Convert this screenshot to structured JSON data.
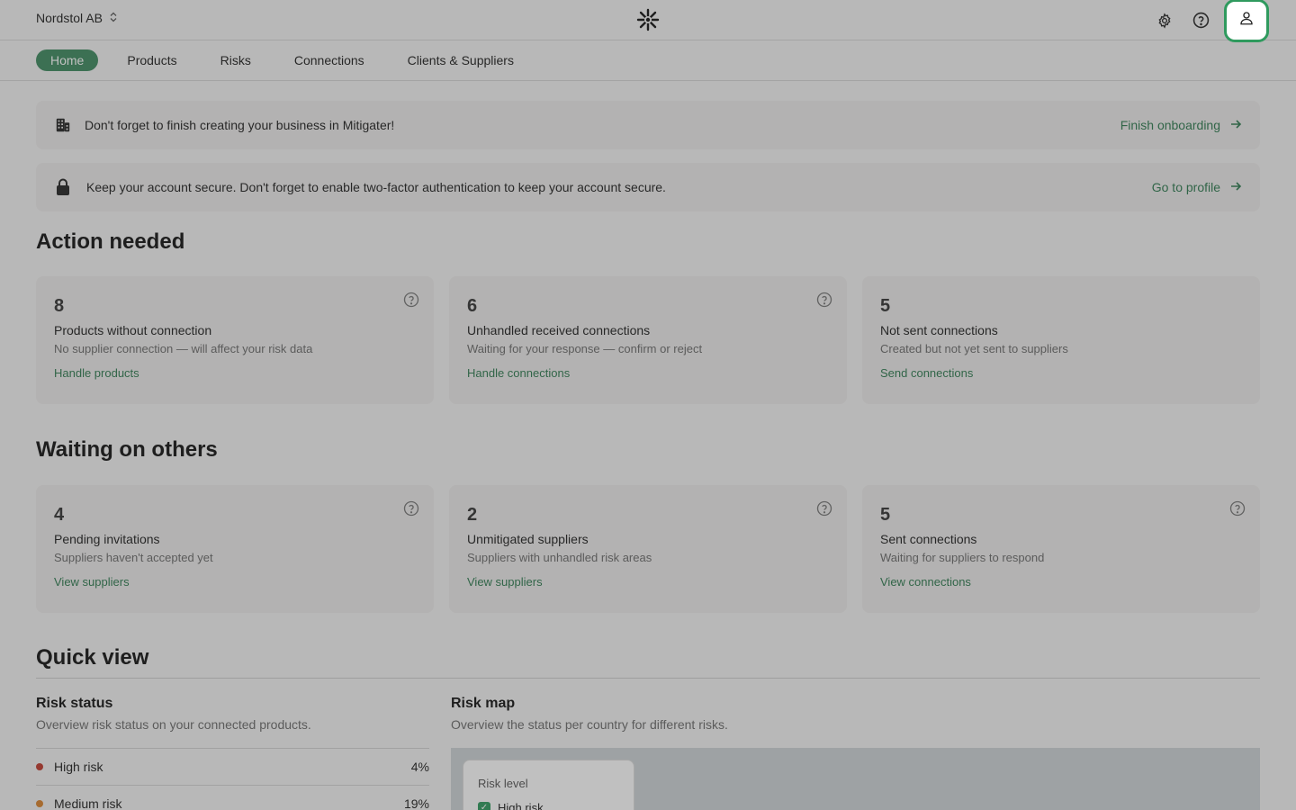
{
  "header": {
    "org_name": "Nordstol AB",
    "org_switch_icon": "up-down-chevron-icon",
    "logo_icon": "starburst-logo-icon",
    "settings_icon": "gear-icon",
    "help_icon": "help-circle-icon",
    "profile_icon": "user-icon"
  },
  "nav": {
    "items": [
      {
        "label": "Home",
        "active": true
      },
      {
        "label": "Products",
        "active": false
      },
      {
        "label": "Risks",
        "active": false
      },
      {
        "label": "Connections",
        "active": false
      },
      {
        "label": "Clients & Suppliers",
        "active": false
      }
    ]
  },
  "banners": [
    {
      "icon": "building-icon",
      "text": "Don't forget to finish creating your business in Mitigater!",
      "link": "Finish onboarding"
    },
    {
      "icon": "lock-icon",
      "text": "Keep your account secure. Don't forget to enable two-factor authentication to keep your account secure.",
      "link": "Go to profile"
    }
  ],
  "action_needed": {
    "title": "Action needed",
    "cards": [
      {
        "count": "8",
        "title": "Products without connection",
        "desc": "No supplier connection — will affect your risk data",
        "link": "Handle products"
      },
      {
        "count": "6",
        "title": "Unhandled received connections",
        "desc": "Waiting for your response — confirm or reject",
        "link": "Handle connections"
      },
      {
        "count": "5",
        "title": "Not sent connections",
        "desc": "Created but not yet sent to suppliers",
        "link": "Send connections"
      }
    ]
  },
  "waiting": {
    "title": "Waiting on others",
    "cards": [
      {
        "count": "4",
        "title": "Pending invitations",
        "desc": "Suppliers haven't accepted yet",
        "link": "View suppliers"
      },
      {
        "count": "2",
        "title": "Unmitigated suppliers",
        "desc": "Suppliers with unhandled risk areas",
        "link": "View suppliers"
      },
      {
        "count": "5",
        "title": "Sent connections",
        "desc": "Waiting for suppliers to respond",
        "link": "View connections"
      }
    ]
  },
  "quick_view": {
    "title": "Quick view",
    "risk_status": {
      "title": "Risk status",
      "desc": "Overview risk status on your connected products.",
      "rows": [
        {
          "label": "High risk",
          "value": "4%",
          "color": "#c0392b"
        },
        {
          "label": "Medium risk",
          "value": "19%",
          "color": "#d9822b"
        }
      ]
    },
    "risk_map": {
      "title": "Risk map",
      "desc": "Overview the status per country for different risks.",
      "legend_title": "Risk level",
      "legend_items": [
        {
          "label": "High risk",
          "checked": true
        }
      ]
    }
  },
  "colors": {
    "accent": "#3d8a5f",
    "link": "#2d7a4f",
    "focus": "#2f9a5e"
  }
}
